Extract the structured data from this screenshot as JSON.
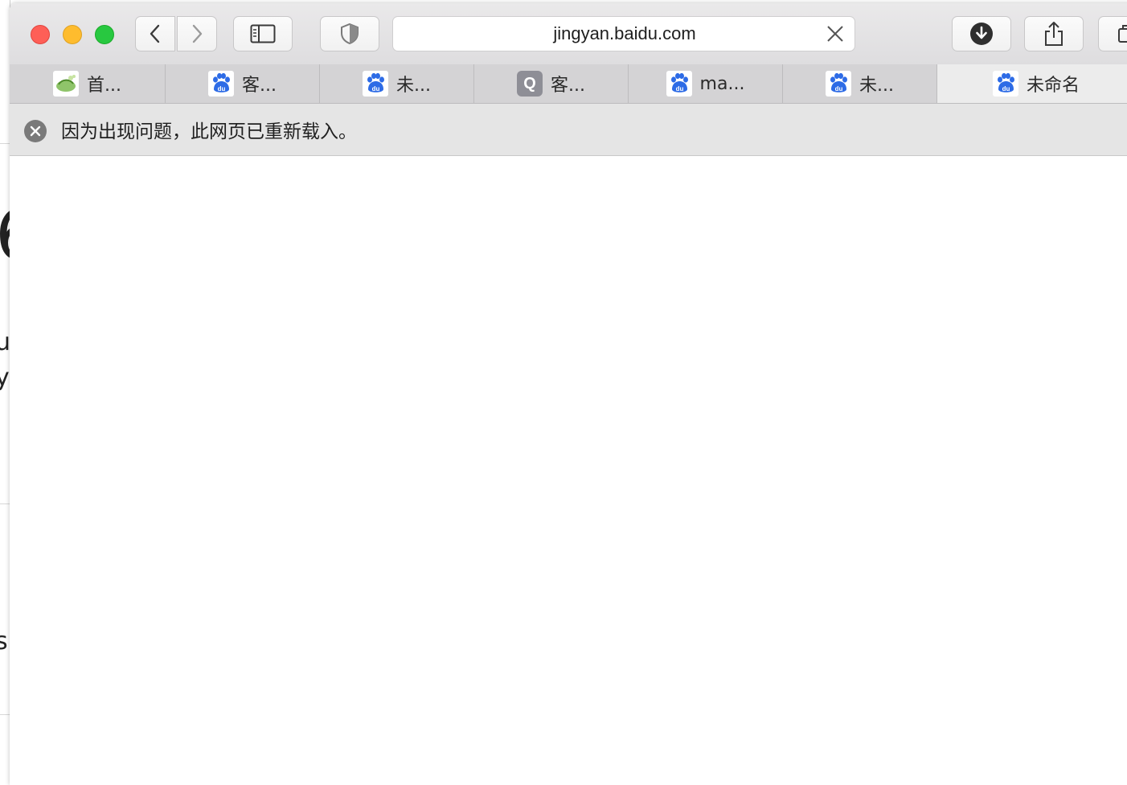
{
  "browser": {
    "address_bar": {
      "url": "jingyan.baidu.com"
    },
    "toolbar": {
      "back_icon": "chevron-left-icon",
      "forward_icon": "chevron-right-icon",
      "sidebar_icon": "sidebar-icon",
      "privacy_icon": "shield-icon",
      "download_icon": "download-icon",
      "share_icon": "share-icon",
      "tabs_icon": "tab-overview-icon"
    },
    "tabs": [
      {
        "label": "首...",
        "favicon": "leaf-favicon",
        "active": false
      },
      {
        "label": "客...",
        "favicon": "baidu-paw-favicon",
        "active": false
      },
      {
        "label": "未...",
        "favicon": "baidu-paw-favicon",
        "active": false
      },
      {
        "label": "客...",
        "favicon": "q-favicon",
        "favicon_text": "Q",
        "active": false
      },
      {
        "label": "ma...",
        "favicon": "baidu-paw-favicon",
        "active": false
      },
      {
        "label": "未...",
        "favicon": "baidu-paw-favicon",
        "active": false
      },
      {
        "label": "未命名",
        "favicon": "baidu-paw-favicon",
        "active": true
      }
    ],
    "notice": {
      "icon": "close-circle-icon",
      "message": "因为出现问题，此网页已重新载入。"
    }
  },
  "colors": {
    "traffic_red": "#fe5f57",
    "traffic_yellow": "#febc2e",
    "traffic_green": "#28c840",
    "baidu_blue": "#2d6be6"
  }
}
